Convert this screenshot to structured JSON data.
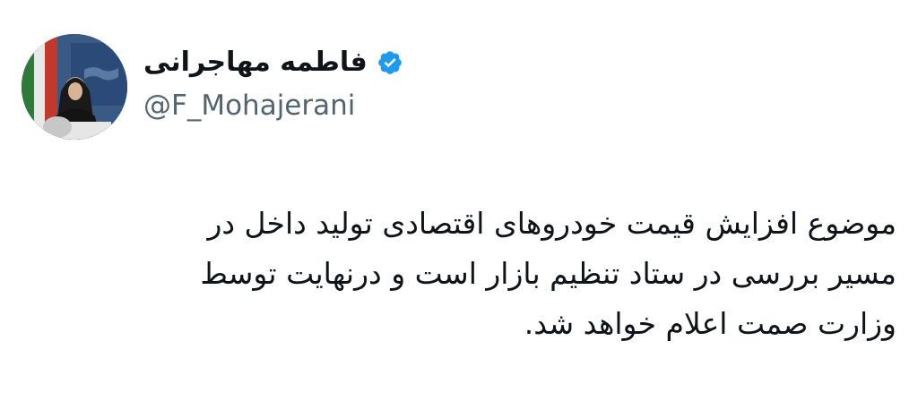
{
  "author": {
    "display_name": "فاطمه مهاجرانی",
    "handle": "@F_Mohajerani",
    "verified": true,
    "verified_icon": "verified-badge-icon",
    "accent_color": "#1d9bf0"
  },
  "avatar": {
    "icon": "profile-photo"
  },
  "tweet": {
    "lines": [
      "موضوع افزایش قیمت خودروهای اقتصادی تولید داخل در",
      "مسیر بررسی در ستاد تنظیم بازار است و درنهایت توسط",
      "وزارت صمت اعلام خواهد شد."
    ]
  }
}
